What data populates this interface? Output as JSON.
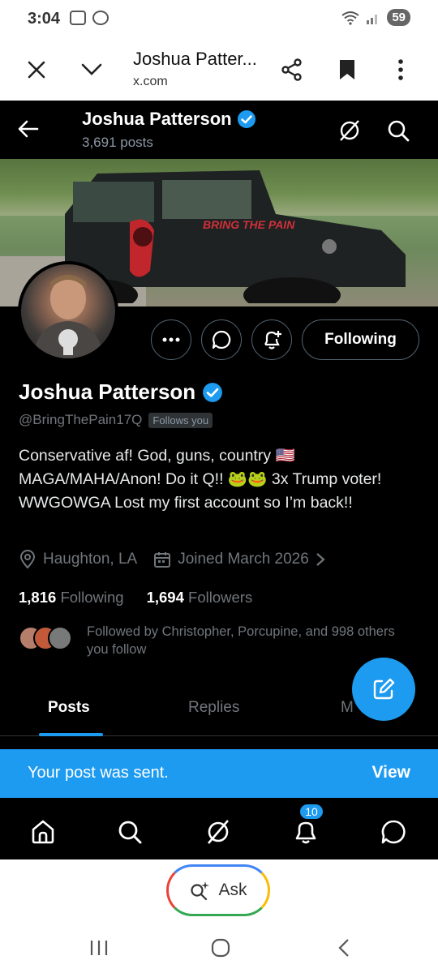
{
  "status_bar": {
    "time": "3:04",
    "battery": "59"
  },
  "browser": {
    "title": "Joshua Patter...",
    "url": "x.com"
  },
  "header": {
    "name": "Joshua Patterson",
    "posts": "3,691 posts"
  },
  "banner": {
    "decal_text": "BRING THE PAIN"
  },
  "actions": {
    "following_label": "Following"
  },
  "profile": {
    "name": "Joshua Patterson",
    "handle": "@BringThePain17Q",
    "follows_you": "Follows you",
    "bio": "Conservative af! God, guns, country 🇺🇸 MAGA/MAHA/Anon! Do it Q!! 🐸🐸 3x Trump voter! WWGOWGA Lost my first account so I’m back!!",
    "location": "Haughton, LA",
    "joined": "Joined March 2026",
    "following_count": "1,816",
    "following_label": "Following",
    "followers_count": "1,694",
    "followers_label": "Followers",
    "followed_by": "Followed by Christopher, Porcupine, and 998 others you follow"
  },
  "tabs": [
    {
      "label": "Posts",
      "active": true
    },
    {
      "label": "Replies",
      "active": false
    },
    {
      "label": "M",
      "active": false
    }
  ],
  "toast": {
    "message": "Your post was sent.",
    "action": "View"
  },
  "bottom_nav": {
    "notifications_badge": "10"
  },
  "ask": {
    "label": "Ask"
  },
  "colors": {
    "accent": "#1d9bf0",
    "background": "#000000",
    "muted": "#71767b"
  }
}
